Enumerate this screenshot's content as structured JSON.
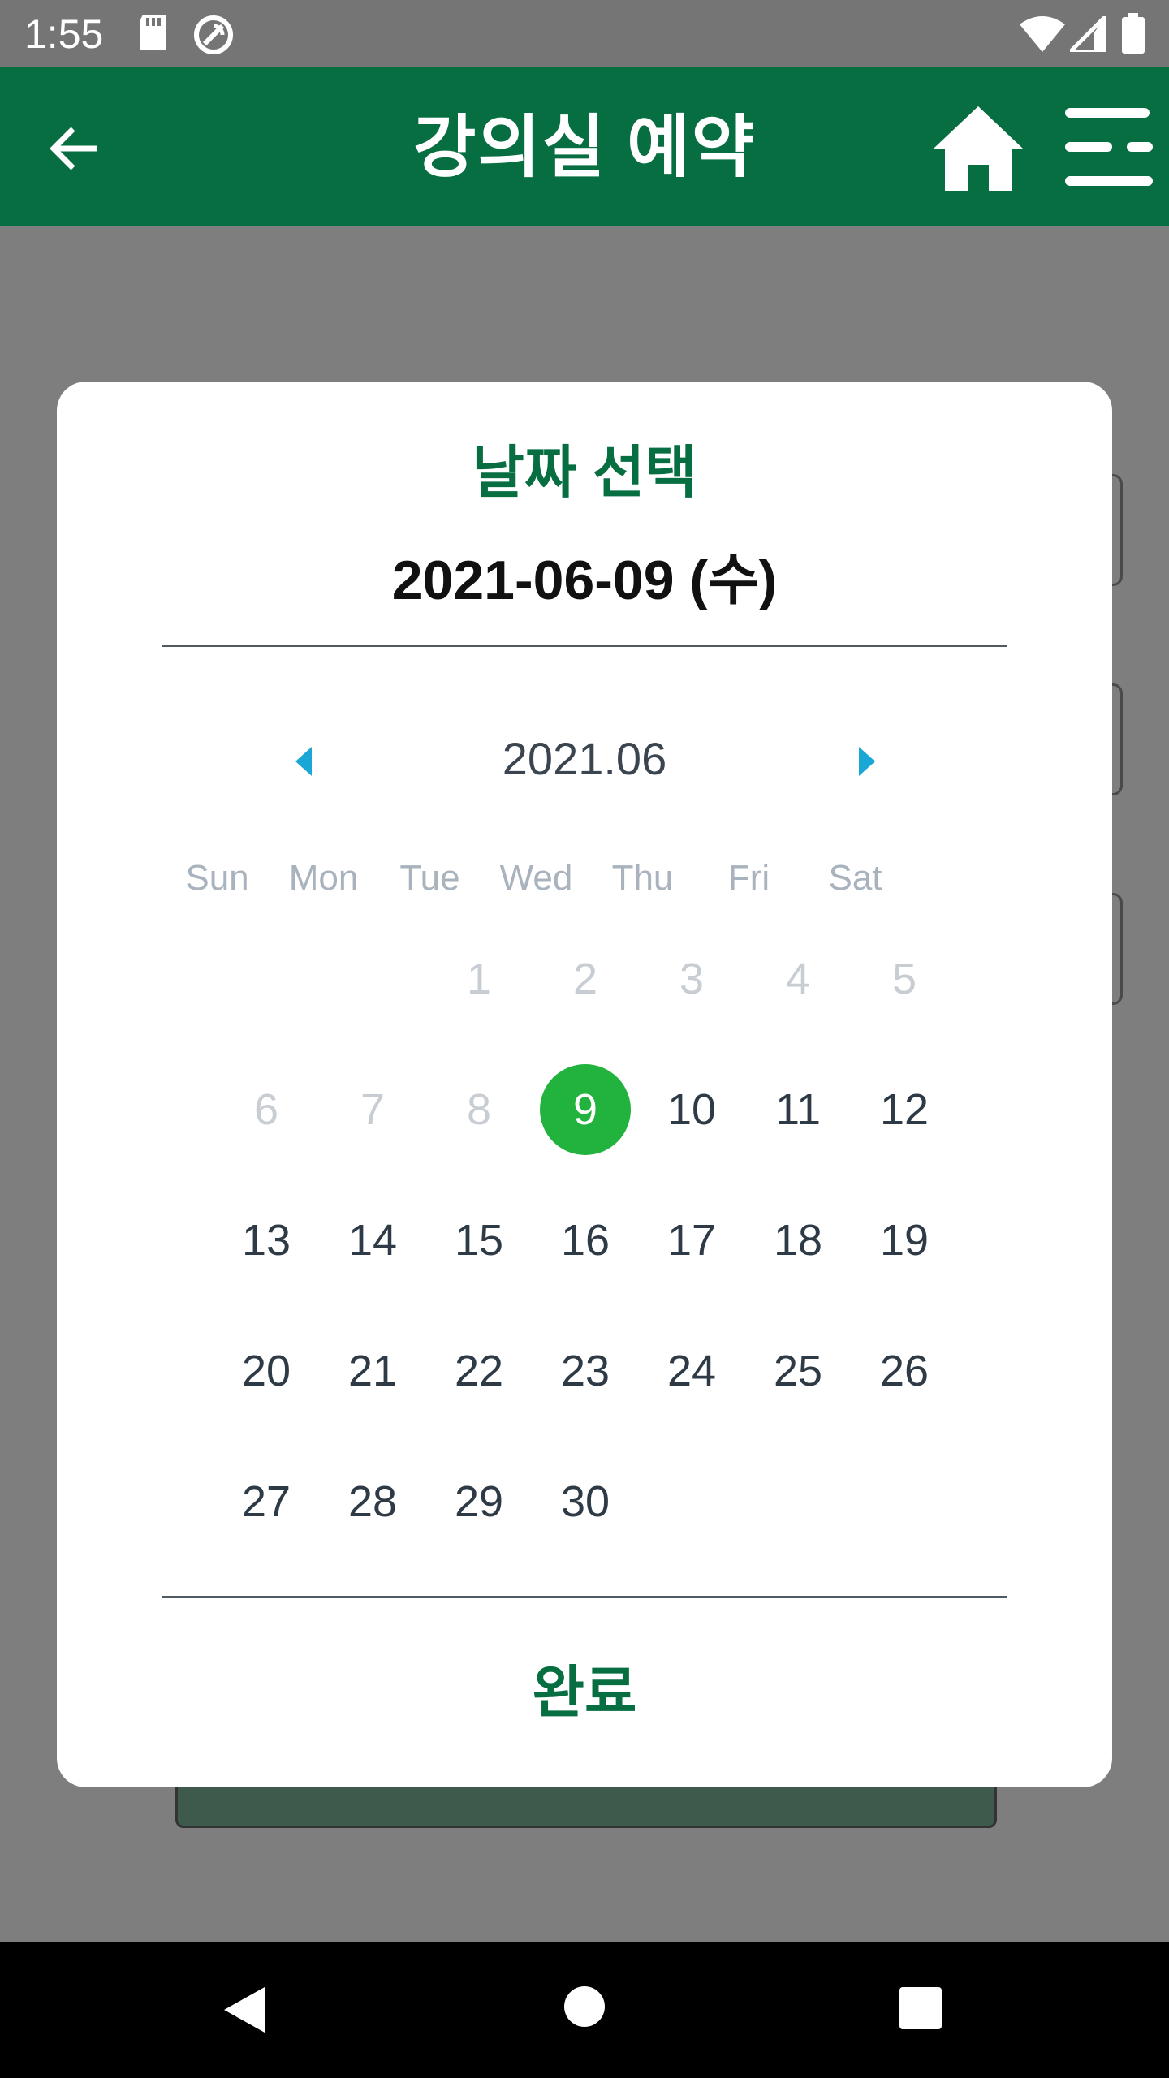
{
  "status_bar": {
    "time": "1:55"
  },
  "app_bar": {
    "title": "강의실 예약",
    "back_icon": "arrow-left-icon",
    "home_icon": "home-icon",
    "menu_icon": "menu-icon"
  },
  "dialog": {
    "title": "날짜 선택",
    "selected_date": "2021-06-09 (수)",
    "month_label": "2021.06",
    "weekdays": [
      "Sun",
      "Mon",
      "Tue",
      "Wed",
      "Thu",
      "Fri",
      "Sat"
    ],
    "days": [
      {
        "label": "1",
        "col": 2,
        "row": 0,
        "disabled": true
      },
      {
        "label": "2",
        "col": 3,
        "row": 0,
        "disabled": true
      },
      {
        "label": "3",
        "col": 4,
        "row": 0,
        "disabled": true
      },
      {
        "label": "4",
        "col": 5,
        "row": 0,
        "disabled": true
      },
      {
        "label": "5",
        "col": 6,
        "row": 0,
        "disabled": true
      },
      {
        "label": "6",
        "col": 0,
        "row": 1,
        "disabled": true
      },
      {
        "label": "7",
        "col": 1,
        "row": 1,
        "disabled": true
      },
      {
        "label": "8",
        "col": 2,
        "row": 1,
        "disabled": true
      },
      {
        "label": "9",
        "col": 3,
        "row": 1,
        "selected": true
      },
      {
        "label": "10",
        "col": 4,
        "row": 1
      },
      {
        "label": "11",
        "col": 5,
        "row": 1
      },
      {
        "label": "12",
        "col": 6,
        "row": 1
      },
      {
        "label": "13",
        "col": 0,
        "row": 2
      },
      {
        "label": "14",
        "col": 1,
        "row": 2
      },
      {
        "label": "15",
        "col": 2,
        "row": 2
      },
      {
        "label": "16",
        "col": 3,
        "row": 2
      },
      {
        "label": "17",
        "col": 4,
        "row": 2
      },
      {
        "label": "18",
        "col": 5,
        "row": 2
      },
      {
        "label": "19",
        "col": 6,
        "row": 2
      },
      {
        "label": "20",
        "col": 0,
        "row": 3
      },
      {
        "label": "21",
        "col": 1,
        "row": 3
      },
      {
        "label": "22",
        "col": 2,
        "row": 3
      },
      {
        "label": "23",
        "col": 3,
        "row": 3
      },
      {
        "label": "24",
        "col": 4,
        "row": 3
      },
      {
        "label": "25",
        "col": 5,
        "row": 3
      },
      {
        "label": "26",
        "col": 6,
        "row": 3
      },
      {
        "label": "27",
        "col": 0,
        "row": 4
      },
      {
        "label": "28",
        "col": 1,
        "row": 4
      },
      {
        "label": "29",
        "col": 2,
        "row": 4
      },
      {
        "label": "30",
        "col": 3,
        "row": 4
      }
    ],
    "done_label": "완료"
  },
  "colors": {
    "brand_green": "#076e42",
    "selected_day": "#21b33e",
    "nav_arrow": "#1ba7d6"
  }
}
